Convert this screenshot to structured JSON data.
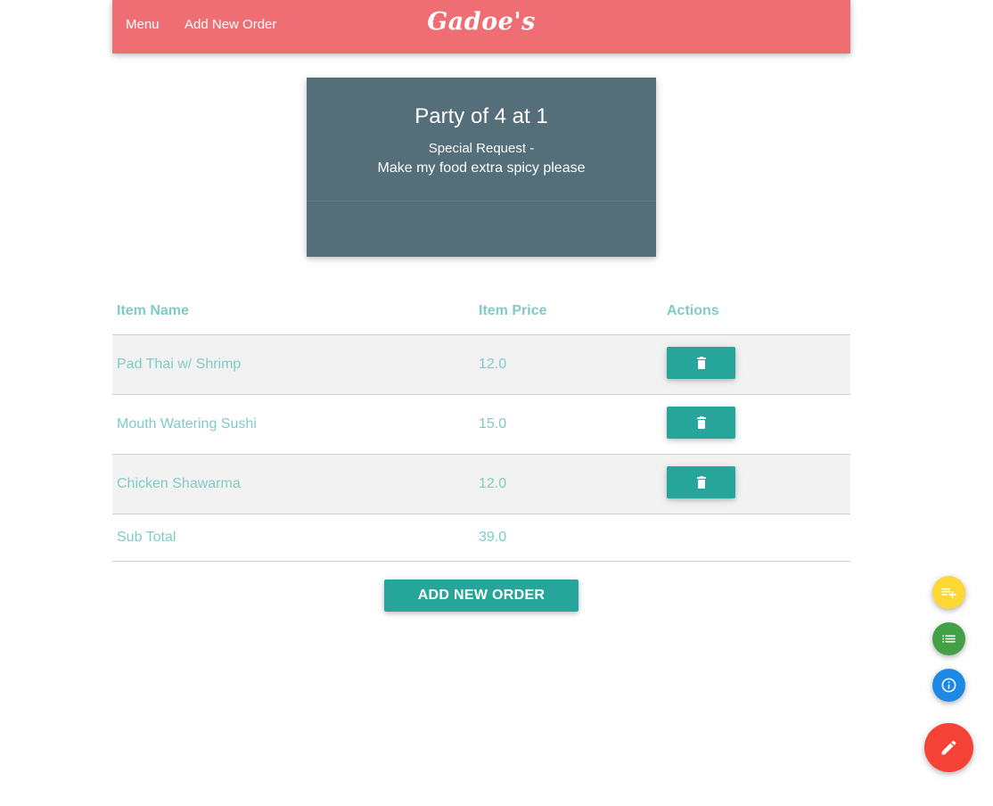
{
  "nav": {
    "menu_label": "Menu",
    "add_order_label": "Add New Order",
    "brand": "Gadoe's"
  },
  "party_card": {
    "title": "Party of 4 at 1",
    "request_label": "Special Request -",
    "request_text": "Make my food extra spicy please"
  },
  "orders_table": {
    "headers": [
      "Item Name",
      "Item Price",
      "Actions"
    ],
    "rows": [
      {
        "name": "Pad Thai w/ Shrimp",
        "price": "12.0"
      },
      {
        "name": "Mouth Watering Sushi",
        "price": "15.0"
      },
      {
        "name": "Chicken Shawarma",
        "price": "12.0"
      }
    ],
    "subtotal_label": "Sub Total",
    "subtotal_value": "39.0",
    "delete_icon": "trash-icon"
  },
  "add_order_button": "ADD NEW ORDER",
  "fab_menu": {
    "items": [
      {
        "icon": "playlist-add-icon",
        "color": "#fdd835"
      },
      {
        "icon": "list-icon",
        "color": "#43a047"
      },
      {
        "icon": "info-icon",
        "color": "#1e88e5"
      }
    ],
    "main": {
      "icon": "edit-pencil-icon",
      "color": "#f44336"
    }
  },
  "colors": {
    "navbar": "#ef6e73",
    "card": "#546e7a",
    "accent": "#26a69a",
    "table_text": "#80cbc4"
  }
}
